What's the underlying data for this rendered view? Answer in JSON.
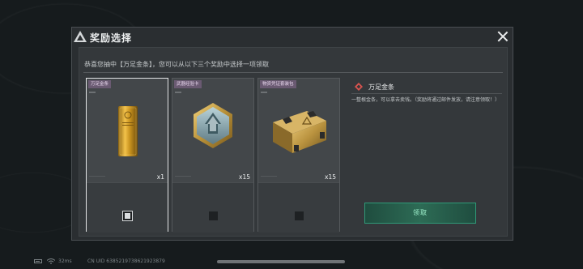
{
  "dialog": {
    "title": "奖励选择",
    "subtitle": "恭喜您抽中【万足金条】，您可以从以下三个奖励中选择一项领取"
  },
  "cards": [
    {
      "tag": "万足金条",
      "qty": "x1",
      "selected": true,
      "icon": "gold-bar-icon"
    },
    {
      "tag": "武器经验卡",
      "qty": "x15",
      "selected": false,
      "icon": "weapon-xp-card-icon"
    },
    {
      "tag": "物资凭证套装包",
      "qty": "x15",
      "selected": false,
      "icon": "supply-crate-icon"
    }
  ],
  "detail": {
    "title": "万足金条",
    "description": "一整根金条，可以拿去卖钱。（奖励将通过邮件发放，请注意领取！）",
    "claim_label": "领取"
  },
  "status": {
    "ping": "32ms",
    "uid": "CN UID 6385219738621923879"
  },
  "colors": {
    "accent": "#2f9a78",
    "tag_bg": "#6a5a72",
    "detail_icon": "#d9534f"
  }
}
